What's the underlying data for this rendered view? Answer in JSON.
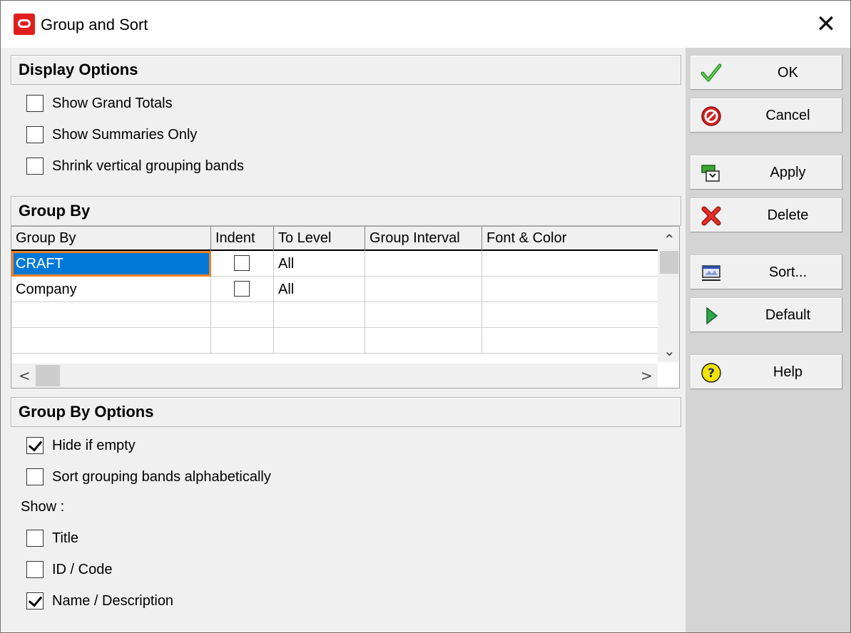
{
  "window": {
    "title": "Group and Sort",
    "close_glyph": "✕"
  },
  "display_options": {
    "header": "Display Options",
    "items": [
      {
        "label": "Show Grand Totals",
        "checked": false
      },
      {
        "label": "Show Summaries Only",
        "checked": false
      },
      {
        "label": "Shrink vertical grouping bands",
        "checked": false
      }
    ]
  },
  "group_by": {
    "header": "Group By",
    "columns": [
      "Group By",
      "Indent",
      "To Level",
      "Group Interval",
      "Font & Color"
    ],
    "rows": [
      {
        "group_by": "CRAFT",
        "indent": false,
        "to_level": "All",
        "group_interval": "",
        "font_color": "",
        "selected": true
      },
      {
        "group_by": "Company",
        "indent": false,
        "to_level": "All",
        "group_interval": "",
        "font_color": "",
        "selected": false
      },
      {
        "group_by": "",
        "to_level": "",
        "group_interval": "",
        "font_color": ""
      },
      {
        "group_by": "",
        "to_level": "",
        "group_interval": "",
        "font_color": ""
      }
    ],
    "scroll": {
      "up": "⌃",
      "down": "⌄",
      "left": "<",
      "right": ">"
    }
  },
  "group_by_options": {
    "header": "Group By Options",
    "items": [
      {
        "label": "Hide if empty",
        "checked": true
      },
      {
        "label": "Sort grouping bands alphabetically",
        "checked": false
      }
    ],
    "show_label": "Show :",
    "show_items": [
      {
        "label": "Title",
        "checked": false
      },
      {
        "label": "ID / Code",
        "checked": false
      },
      {
        "label": "Name / Description",
        "checked": true
      }
    ]
  },
  "buttons": {
    "ok": {
      "label": "OK",
      "icon": "checkmark-icon"
    },
    "cancel": {
      "label": "Cancel",
      "icon": "cancel-icon"
    },
    "apply": {
      "label": "Apply",
      "icon": "apply-icon"
    },
    "delete": {
      "label": "Delete",
      "icon": "delete-x-icon"
    },
    "sort": {
      "label": "Sort...",
      "icon": "sort-icon"
    },
    "default": {
      "label": "Default",
      "icon": "play-triangle-icon"
    },
    "help": {
      "label": "Help",
      "icon": "help-icon"
    }
  },
  "colors": {
    "selection": "#0078d7",
    "focus_outline": "#f08020",
    "ok_green": "#3aa832",
    "cancel_red": "#d42020",
    "help_yellow": "#f2e200"
  }
}
